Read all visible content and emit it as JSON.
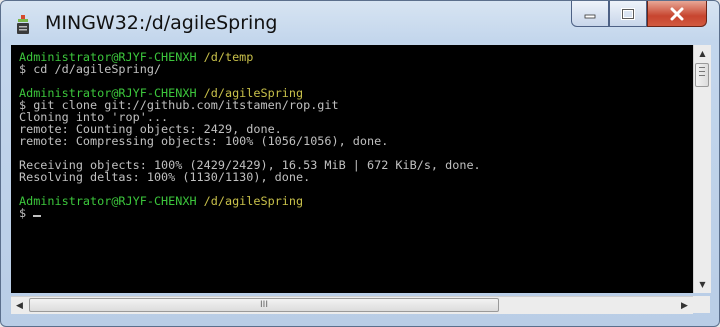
{
  "window": {
    "title": "MINGW32:/d/agileSpring"
  },
  "controls": {
    "minimize_icon": "minimize-icon",
    "maximize_icon": "maximize-icon",
    "close_icon": "close-icon"
  },
  "terminal": {
    "lines": [
      {
        "prompt_user": "Administrator@RJYF-CHENXH",
        "prompt_path": "/d/temp"
      },
      {
        "text": "$ cd /d/agileSpring/"
      },
      {
        "blank": true
      },
      {
        "prompt_user": "Administrator@RJYF-CHENXH",
        "prompt_path": "/d/agileSpring"
      },
      {
        "text": "$ git clone git://github.com/itstamen/rop.git"
      },
      {
        "text": "Cloning into 'rop'..."
      },
      {
        "text": "remote: Counting objects: 2429, done."
      },
      {
        "text": "remote: Compressing objects: 100% (1056/1056), done."
      },
      {
        "blank": true
      },
      {
        "text": "Receiving objects: 100% (2429/2429), 16.53 MiB | 672 KiB/s, done."
      },
      {
        "text": "Resolving deltas: 100% (1130/1130), done."
      },
      {
        "blank": true
      },
      {
        "prompt_user": "Administrator@RJYF-CHENXH",
        "prompt_path": "/d/agileSpring"
      },
      {
        "text": "$ "
      }
    ]
  },
  "scrollbar": {
    "h_thumb_grip": "III"
  },
  "colors": {
    "prompt_user": "#3cc63c",
    "prompt_path": "#c8c04a",
    "text": "#c0c0c0",
    "background": "#000000"
  }
}
